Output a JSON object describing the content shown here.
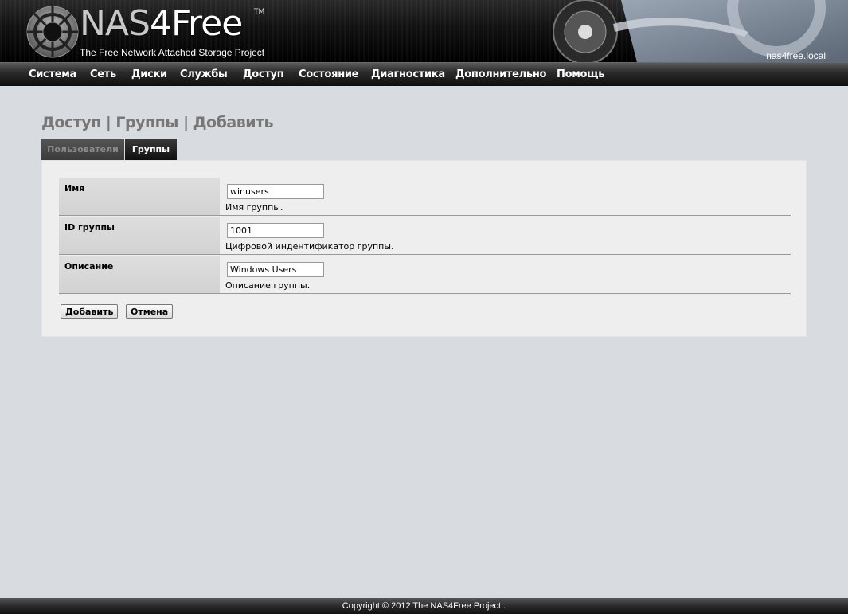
{
  "header": {
    "logo_main": "NAS",
    "logo_accent": "4Free",
    "logo_tm": "TM",
    "tagline": "The Free Network Attached Storage Project",
    "hostname": "nas4free.local"
  },
  "nav": {
    "items": [
      {
        "label": "Система"
      },
      {
        "label": "Сеть"
      },
      {
        "label": "Диски"
      },
      {
        "label": "Службы"
      },
      {
        "label": "Доступ"
      },
      {
        "label": "Состояние"
      },
      {
        "label": "Диагностика"
      },
      {
        "label": "Дополнительно"
      },
      {
        "label": "Помощь"
      }
    ]
  },
  "page": {
    "title": "Доступ | Группы | Добавить"
  },
  "tabs": [
    {
      "label": "Пользователи",
      "active": false
    },
    {
      "label": "Группы",
      "active": true
    }
  ],
  "form": {
    "rows": [
      {
        "label": "Имя",
        "value": "winusers",
        "hint": "Имя группы."
      },
      {
        "label": "ID группы",
        "value": "1001",
        "hint": "Цифровой индентификатор группы."
      },
      {
        "label": "Описание",
        "value": "Windows Users",
        "hint": "Описание группы."
      }
    ],
    "add_label": "Добавить",
    "cancel_label": "Отмена"
  },
  "footer": {
    "copyright": "Copyright © 2012 The NAS4Free Project ."
  },
  "colors": {
    "background": "#d8dbe0",
    "panel": "#eeeeee",
    "title": "#777777"
  }
}
